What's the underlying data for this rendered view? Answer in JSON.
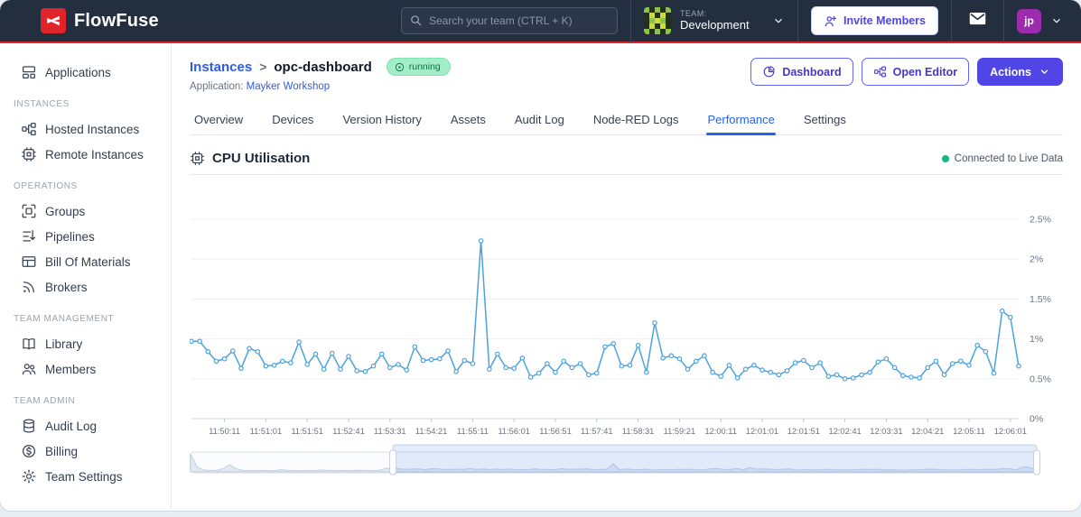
{
  "navbar": {
    "brand": "FlowFuse",
    "search_placeholder": "Search your team (CTRL + K)",
    "team_label": "TEAM:",
    "team_name": "Development",
    "invite_label": "Invite Members",
    "avatar_initials": "jp"
  },
  "sidebar": {
    "sections": [
      {
        "header": "",
        "items": [
          {
            "label": "Applications",
            "icon": "applications-icon"
          }
        ]
      },
      {
        "header": "INSTANCES",
        "items": [
          {
            "label": "Hosted Instances",
            "icon": "hosted-instances-icon"
          },
          {
            "label": "Remote Instances",
            "icon": "remote-instances-icon"
          }
        ]
      },
      {
        "header": "OPERATIONS",
        "items": [
          {
            "label": "Groups",
            "icon": "groups-icon"
          },
          {
            "label": "Pipelines",
            "icon": "pipelines-icon"
          },
          {
            "label": "Bill Of Materials",
            "icon": "bill-of-materials-icon"
          },
          {
            "label": "Brokers",
            "icon": "brokers-icon"
          }
        ]
      },
      {
        "header": "TEAM MANAGEMENT",
        "items": [
          {
            "label": "Library",
            "icon": "library-icon"
          },
          {
            "label": "Members",
            "icon": "members-icon"
          }
        ]
      },
      {
        "header": "TEAM ADMIN",
        "items": [
          {
            "label": "Audit Log",
            "icon": "audit-log-icon"
          },
          {
            "label": "Billing",
            "icon": "billing-icon"
          },
          {
            "label": "Team Settings",
            "icon": "team-settings-icon"
          }
        ]
      }
    ]
  },
  "page": {
    "breadcrumb_root": "Instances",
    "breadcrumb_sep": ">",
    "instance_name": "opc-dashboard",
    "status_badge": "running",
    "application_label": "Application:",
    "application_name": "Mayker Workshop",
    "buttons": {
      "dashboard": "Dashboard",
      "open_editor": "Open Editor",
      "actions": "Actions"
    }
  },
  "tabs": [
    {
      "label": "Overview",
      "active": false
    },
    {
      "label": "Devices",
      "active": false
    },
    {
      "label": "Version History",
      "active": false
    },
    {
      "label": "Assets",
      "active": false
    },
    {
      "label": "Audit Log",
      "active": false
    },
    {
      "label": "Node-RED Logs",
      "active": false
    },
    {
      "label": "Performance",
      "active": true
    },
    {
      "label": "Settings",
      "active": false
    }
  ],
  "panel": {
    "title": "CPU Utilisation",
    "live_status": "Connected to Live Data"
  },
  "chart_data": {
    "type": "line",
    "title": "CPU Utilisation",
    "unit": "%",
    "ylim": [
      0,
      2.5
    ],
    "grid": true,
    "legend": "none",
    "line_color": "#4ba3dd",
    "y_ticks": [
      "0%",
      "0.5%",
      "1%",
      "1.5%",
      "2%",
      "2.5%"
    ],
    "x_ticks": [
      "11:50:11",
      "11:51:01",
      "11:51:51",
      "11:52:41",
      "11:53:31",
      "11:54:21",
      "11:55:11",
      "11:56:01",
      "11:56:51",
      "11:57:41",
      "11:58:31",
      "11:59:21",
      "12:00:11",
      "12:01:01",
      "12:01:51",
      "12:02:41",
      "12:03:31",
      "12:04:21",
      "12:05:11",
      "12:06:01"
    ],
    "x_tick_first_index": 4,
    "x_tick_step": 5,
    "values": [
      0.97,
      0.97,
      0.84,
      0.72,
      0.75,
      0.85,
      0.63,
      0.88,
      0.84,
      0.66,
      0.67,
      0.72,
      0.7,
      0.96,
      0.68,
      0.81,
      0.62,
      0.82,
      0.62,
      0.78,
      0.6,
      0.59,
      0.66,
      0.81,
      0.64,
      0.68,
      0.61,
      0.9,
      0.73,
      0.74,
      0.75,
      0.85,
      0.59,
      0.73,
      0.69,
      2.23,
      0.62,
      0.81,
      0.64,
      0.63,
      0.76,
      0.52,
      0.57,
      0.69,
      0.58,
      0.72,
      0.64,
      0.69,
      0.55,
      0.57,
      0.9,
      0.94,
      0.66,
      0.67,
      0.92,
      0.58,
      1.2,
      0.76,
      0.79,
      0.75,
      0.62,
      0.72,
      0.79,
      0.58,
      0.53,
      0.67,
      0.51,
      0.62,
      0.67,
      0.61,
      0.58,
      0.55,
      0.6,
      0.7,
      0.73,
      0.64,
      0.7,
      0.53,
      0.55,
      0.5,
      0.51,
      0.55,
      0.58,
      0.71,
      0.75,
      0.64,
      0.54,
      0.52,
      0.51,
      0.64,
      0.72,
      0.55,
      0.69,
      0.72,
      0.67,
      0.92,
      0.84,
      0.57,
      1.35,
      1.27,
      0.66
    ],
    "minimap": {
      "selection_start_frac": 0.24,
      "selection_end_frac": 1.0,
      "prefix_values": [
        5.0,
        1.4,
        0.5,
        0.4,
        0.4,
        0.9,
        2.0,
        0.9,
        0.4,
        0.35,
        0.35,
        0.4,
        0.35,
        0.35,
        0.6,
        0.4,
        0.35,
        0.35,
        0.4,
        0.35,
        0.5,
        0.45,
        0.35,
        0.4,
        0.35,
        0.4,
        0.45,
        0.4,
        0.35,
        0.4
      ]
    }
  },
  "colors": {
    "navbar_bg": "#232e3e",
    "accent_red": "#e0242a",
    "indigo": "#4f46e5",
    "link_blue": "#2f5bea",
    "active_tab_blue": "#2563eb",
    "line_blue": "#4ba3dd",
    "badge_green_bg": "#a3eec8",
    "badge_green_text": "#116e46",
    "live_dot_green": "#10b981"
  }
}
